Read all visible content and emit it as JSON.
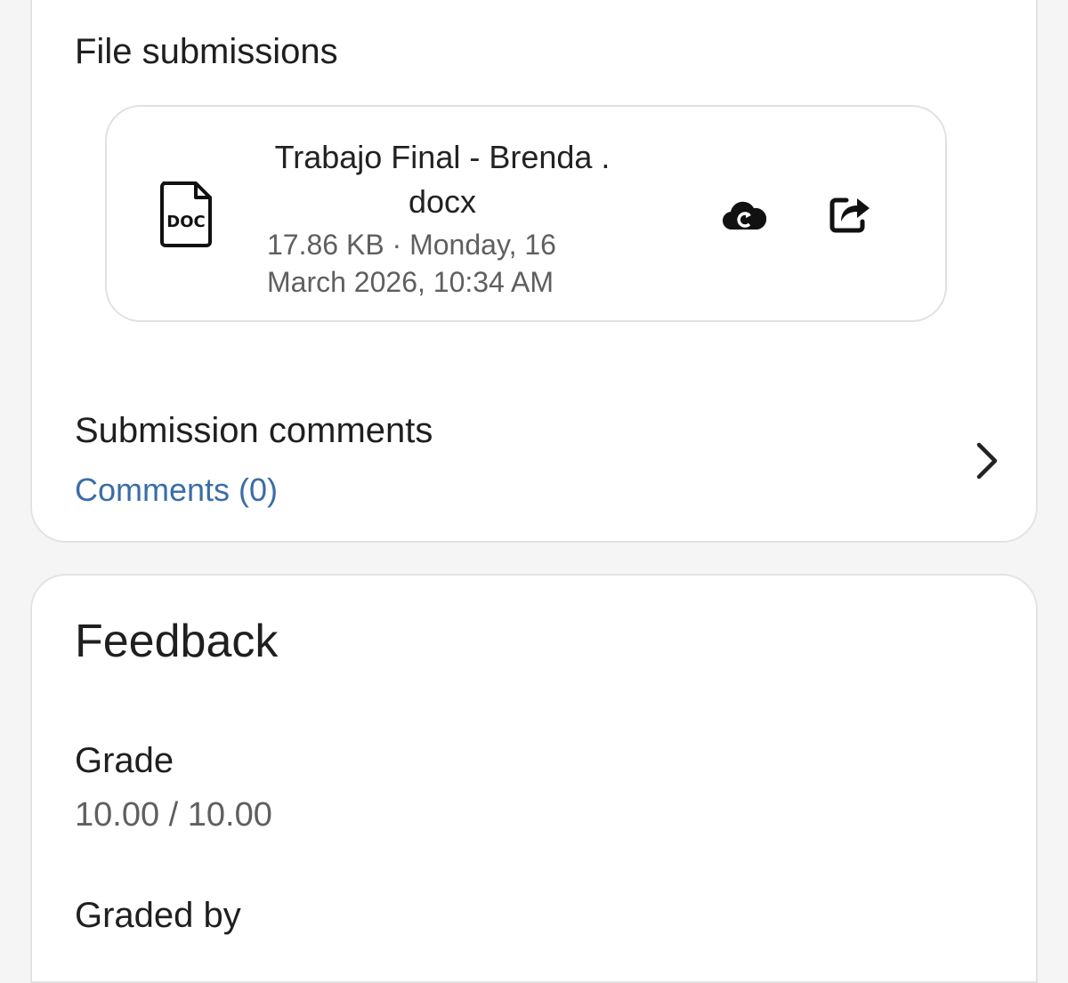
{
  "submissions": {
    "title": "File submissions",
    "file": {
      "name": "Trabajo Final - Brenda .docx",
      "type_label": "DOC",
      "size": "17.86 KB",
      "separator": "·",
      "date": "Monday, 16 March 2026, 10:34 AM",
      "icons": [
        "doc-file-icon",
        "cloud-sync-icon",
        "open-external-icon"
      ]
    }
  },
  "comments": {
    "title": "Submission comments",
    "link": "Comments (0)",
    "icon": "chevron-right-icon"
  },
  "feedback": {
    "title": "Feedback",
    "grade_label": "Grade",
    "grade_value": "10.00 / 10.00",
    "graded_by_label": "Graded by"
  },
  "colors": {
    "link": "#3a6da8",
    "meta_text": "#5f5f5f",
    "border": "#e3e3e3"
  }
}
